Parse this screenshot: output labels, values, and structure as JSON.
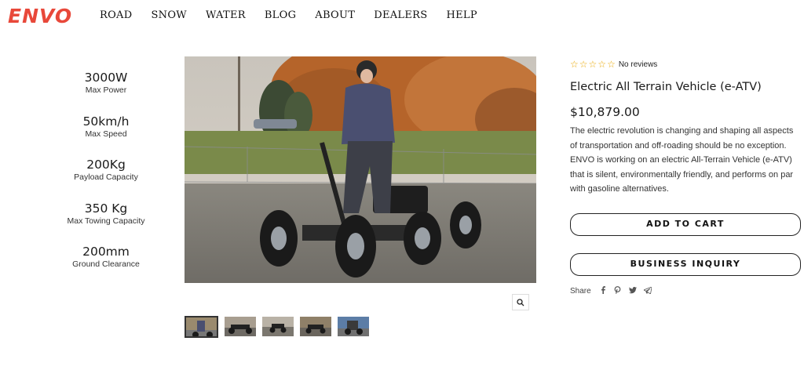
{
  "header": {
    "logo": "ENVO",
    "nav": [
      "ROAD",
      "SNOW",
      "WATER",
      "BLOG",
      "ABOUT",
      "DEALERS",
      "HELP"
    ]
  },
  "specs": [
    {
      "value": "3000W",
      "label": "Max Power"
    },
    {
      "value": "50km/h",
      "label": "Max Speed"
    },
    {
      "value": "200Kg",
      "label": "Payload Capacity"
    },
    {
      "value": "350 Kg",
      "label": "Max Towing Capacity"
    },
    {
      "value": "200mm",
      "label": "Ground Clearance"
    }
  ],
  "product": {
    "rating_stars": 0,
    "reviews": "No reviews",
    "title": "Electric All Terrain Vehicle (e-ATV)",
    "price": "$10,879.00",
    "description": "The electric revolution is changing and shaping all aspects of transportation and off-roading should be no exception. ENVO is working on an electric All-Terrain Vehicle (e-ATV) that is silent, environmentally friendly, and performs on par with gasoline alternatives.",
    "add_to_cart": "ADD TO CART",
    "business_inquiry": "BUSINESS INQUIRY",
    "share_label": "Share",
    "share_icons": [
      "facebook-icon",
      "pinterest-icon",
      "twitter-icon",
      "telegram-icon"
    ]
  },
  "gallery": {
    "thumbnail_count": 5,
    "active_index": 0
  },
  "colors": {
    "brand": "#e8483a",
    "star": "#e8a600"
  }
}
